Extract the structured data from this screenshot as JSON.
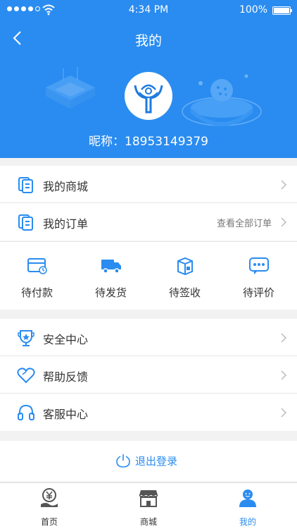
{
  "status_bar": {
    "time": "4:34 PM",
    "battery": "100%",
    "signal_bars": 4
  },
  "header": {
    "title": "我的",
    "nickname_prefix": "昵称：",
    "nickname": "18953149379"
  },
  "menu_top": [
    {
      "label": "我的商城",
      "extra": ""
    },
    {
      "label": "我的订单",
      "extra": "查看全部订单"
    }
  ],
  "orders": [
    {
      "label": "待付款",
      "icon": "wallet-icon"
    },
    {
      "label": "待发货",
      "icon": "truck-icon"
    },
    {
      "label": "待签收",
      "icon": "package-icon"
    },
    {
      "label": "待评价",
      "icon": "comment-icon"
    }
  ],
  "menu_bottom": [
    {
      "label": "安全中心",
      "icon": "trophy-shield-icon"
    },
    {
      "label": "帮助反馈",
      "icon": "heart-icon"
    },
    {
      "label": "客服中心",
      "icon": "headphones-icon"
    }
  ],
  "logout": {
    "label": "退出登录"
  },
  "tabs": [
    {
      "label": "首页",
      "icon": "yen-hand-icon",
      "active": false
    },
    {
      "label": "商城",
      "icon": "store-icon",
      "active": false
    },
    {
      "label": "我的",
      "icon": "user-icon",
      "active": true
    }
  ],
  "colors": {
    "primary": "#2a8cf0",
    "background": "#f2f2f2"
  }
}
